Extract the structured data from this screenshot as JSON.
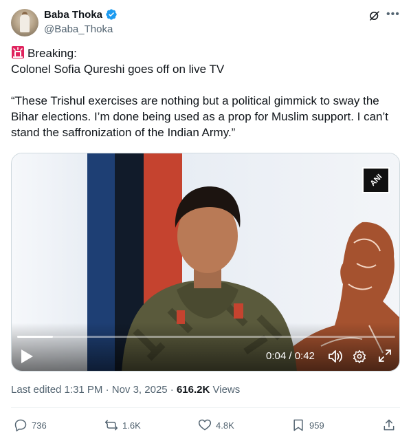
{
  "author": {
    "display_name": "Baba Thoka",
    "handle": "@Baba_Thoka",
    "verified_icon": "verified-badge-icon",
    "avatar_icon": "avatar"
  },
  "header_icons": [
    "grok-icon",
    "more-icon"
  ],
  "post": {
    "line1": "Breaking:",
    "line2": "Colonel Sofia Qureshi goes off on live TV",
    "quote": "“These Trishul exercises are nothing but a political gimmick to sway the Bihar elections. I’m done being used as a prop for Muslim support. I can’t stand the saffronization of the Indian Army.”",
    "siren_icon": "police-siren-icon"
  },
  "video": {
    "watermark": "ANI",
    "time_label": "0:04 / 0:42",
    "progress": 0.095,
    "icons": [
      "play-icon",
      "volume-icon",
      "settings-icon",
      "fullscreen-icon"
    ]
  },
  "meta": {
    "edited": "Last edited 1:31 PM · Nov 3, 2025 · ",
    "views_count": "616.2K",
    "views_label": " Views"
  },
  "actions": {
    "replies": "736",
    "reposts": "1.6K",
    "likes": "4.8K",
    "bookmarks": "959"
  },
  "colors": {
    "verified": "#1d9bf0",
    "text_primary": "#0f1419",
    "text_secondary": "#536471"
  }
}
